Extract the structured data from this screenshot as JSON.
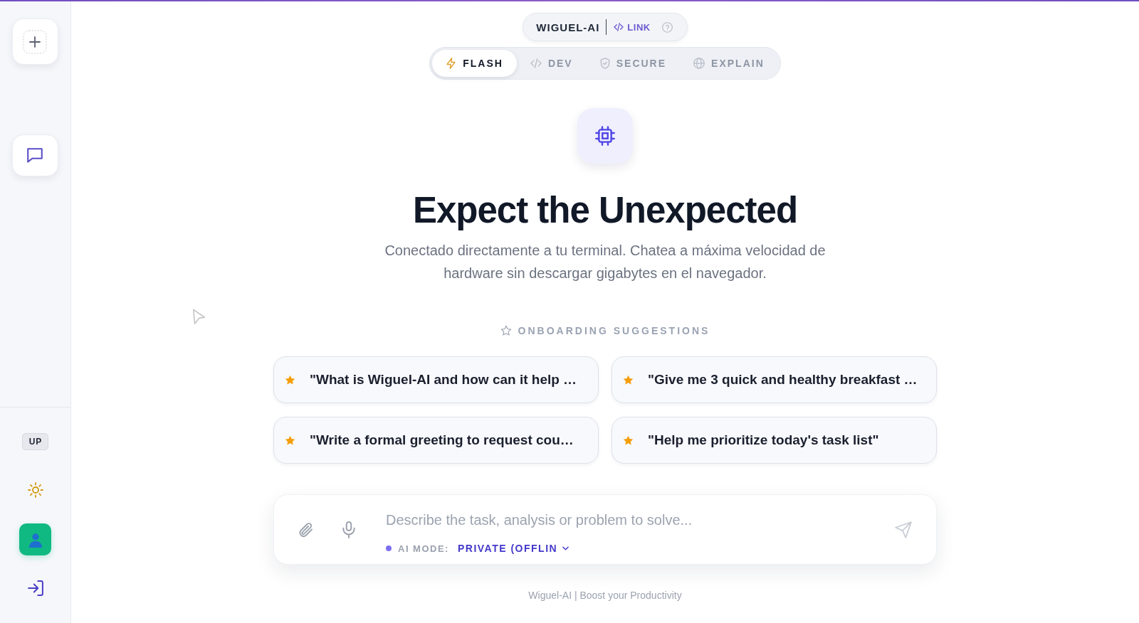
{
  "sidebar": {
    "badge": "UP"
  },
  "header": {
    "brand": "WIGUEL-AI",
    "link": "LINK"
  },
  "tabs": [
    {
      "label": "FLASH",
      "kind": "flash",
      "selected": true
    },
    {
      "label": "DEV",
      "kind": "dev",
      "selected": false
    },
    {
      "label": "SECURE",
      "kind": "secure",
      "selected": false
    },
    {
      "label": "EXPLAIN",
      "kind": "explain",
      "selected": false
    }
  ],
  "hero": {
    "title": "Expect the Unexpected",
    "subtitle": "Conectado directamente a tu terminal. Chatea a máxima velocidad de hardware sin descargar gigabytes en el navegador."
  },
  "suggestions": {
    "heading": "ONBOARDING SUGGESTIONS",
    "items": [
      "\"What is Wiguel-AI and how can it help …",
      "\"Give me 3 quick and healthy breakfast …",
      "\"Write a formal greeting to request cou…",
      "\"Help me prioritize today's task list\""
    ]
  },
  "composer": {
    "placeholder": "Describe the task, analysis or problem to solve...",
    "mode_label": "AI MODE:",
    "mode_value": "PRIVATE (OFFLIN"
  },
  "footer": "Wiguel-AI | Boost your Productivity"
}
